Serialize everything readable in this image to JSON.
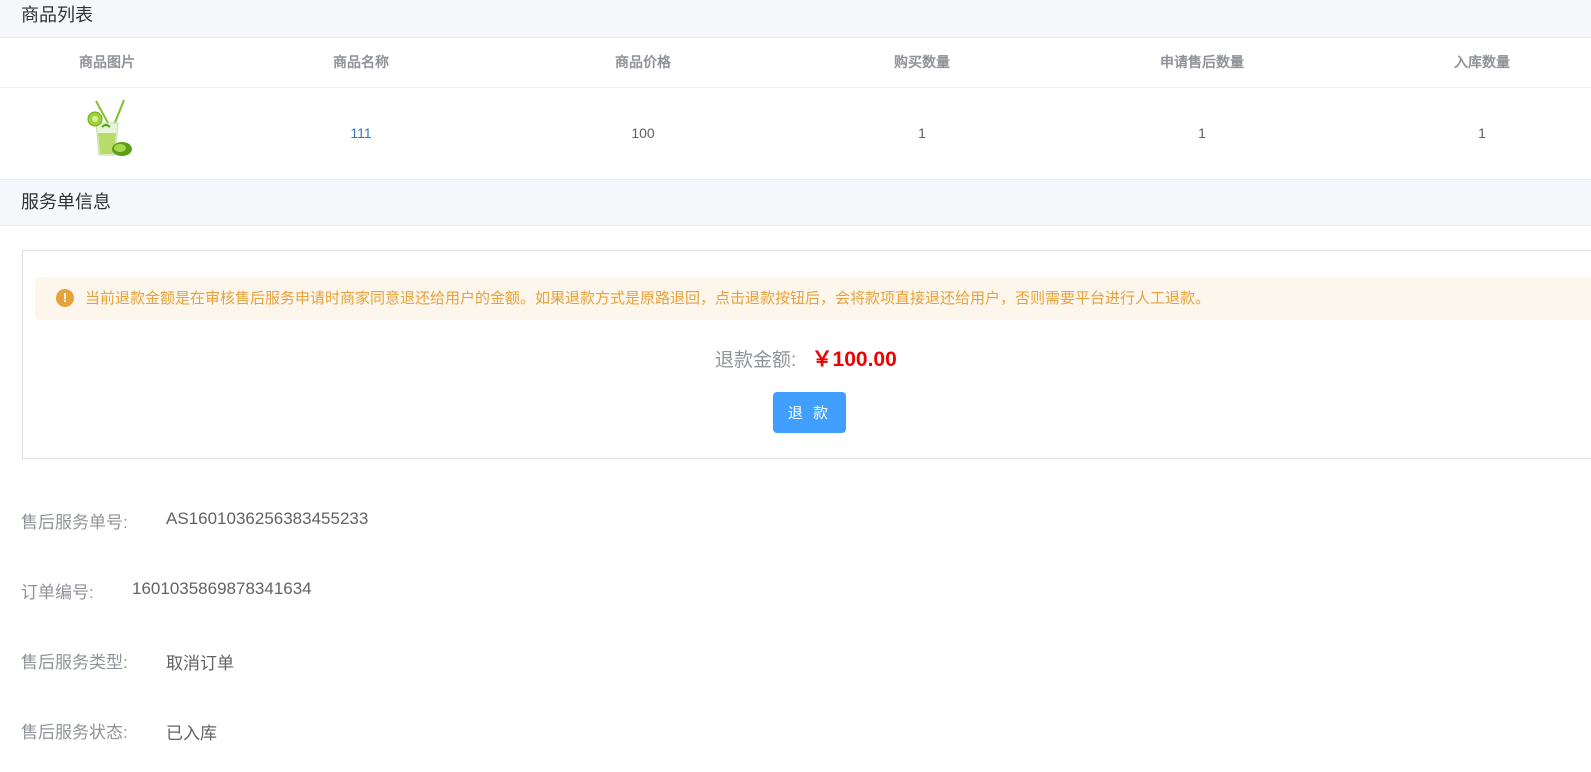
{
  "product_section": {
    "title": "商品列表",
    "columns": [
      "商品图片",
      "商品名称",
      "商品价格",
      "购买数量",
      "申请售后数量",
      "入库数量"
    ],
    "rows": [
      {
        "image_icon": "mojito-drink-image",
        "name": "111",
        "price": "100",
        "buy_qty": "1",
        "aftersale_qty": "1",
        "stock_in_qty": "1"
      }
    ]
  },
  "service_section": {
    "title": "服务单信息",
    "alert": {
      "icon": "warning-icon",
      "glyph": "!",
      "text": "当前退款金额是在审核售后服务申请时商家同意退还给用户的金额。如果退款方式是原路退回，点击退款按钮后，会将款项直接退还给用户，否则需要平台进行人工退款。",
      "color": "#e6a23c",
      "background": "#fdf6ec"
    },
    "refund_label": "退款金额:",
    "refund_value": "￥100.00",
    "refund_button": "退 款",
    "accent": "#409eff",
    "amount_color": "#f00000"
  },
  "info": [
    {
      "label": "售后服务单号:",
      "value": "AS1601036256383455233"
    },
    {
      "label": "订单编号:",
      "value": "1601035869878341634"
    },
    {
      "label": "售后服务类型:",
      "value": "取消订单"
    },
    {
      "label": "售后服务状态:",
      "value": "已入库"
    }
  ]
}
